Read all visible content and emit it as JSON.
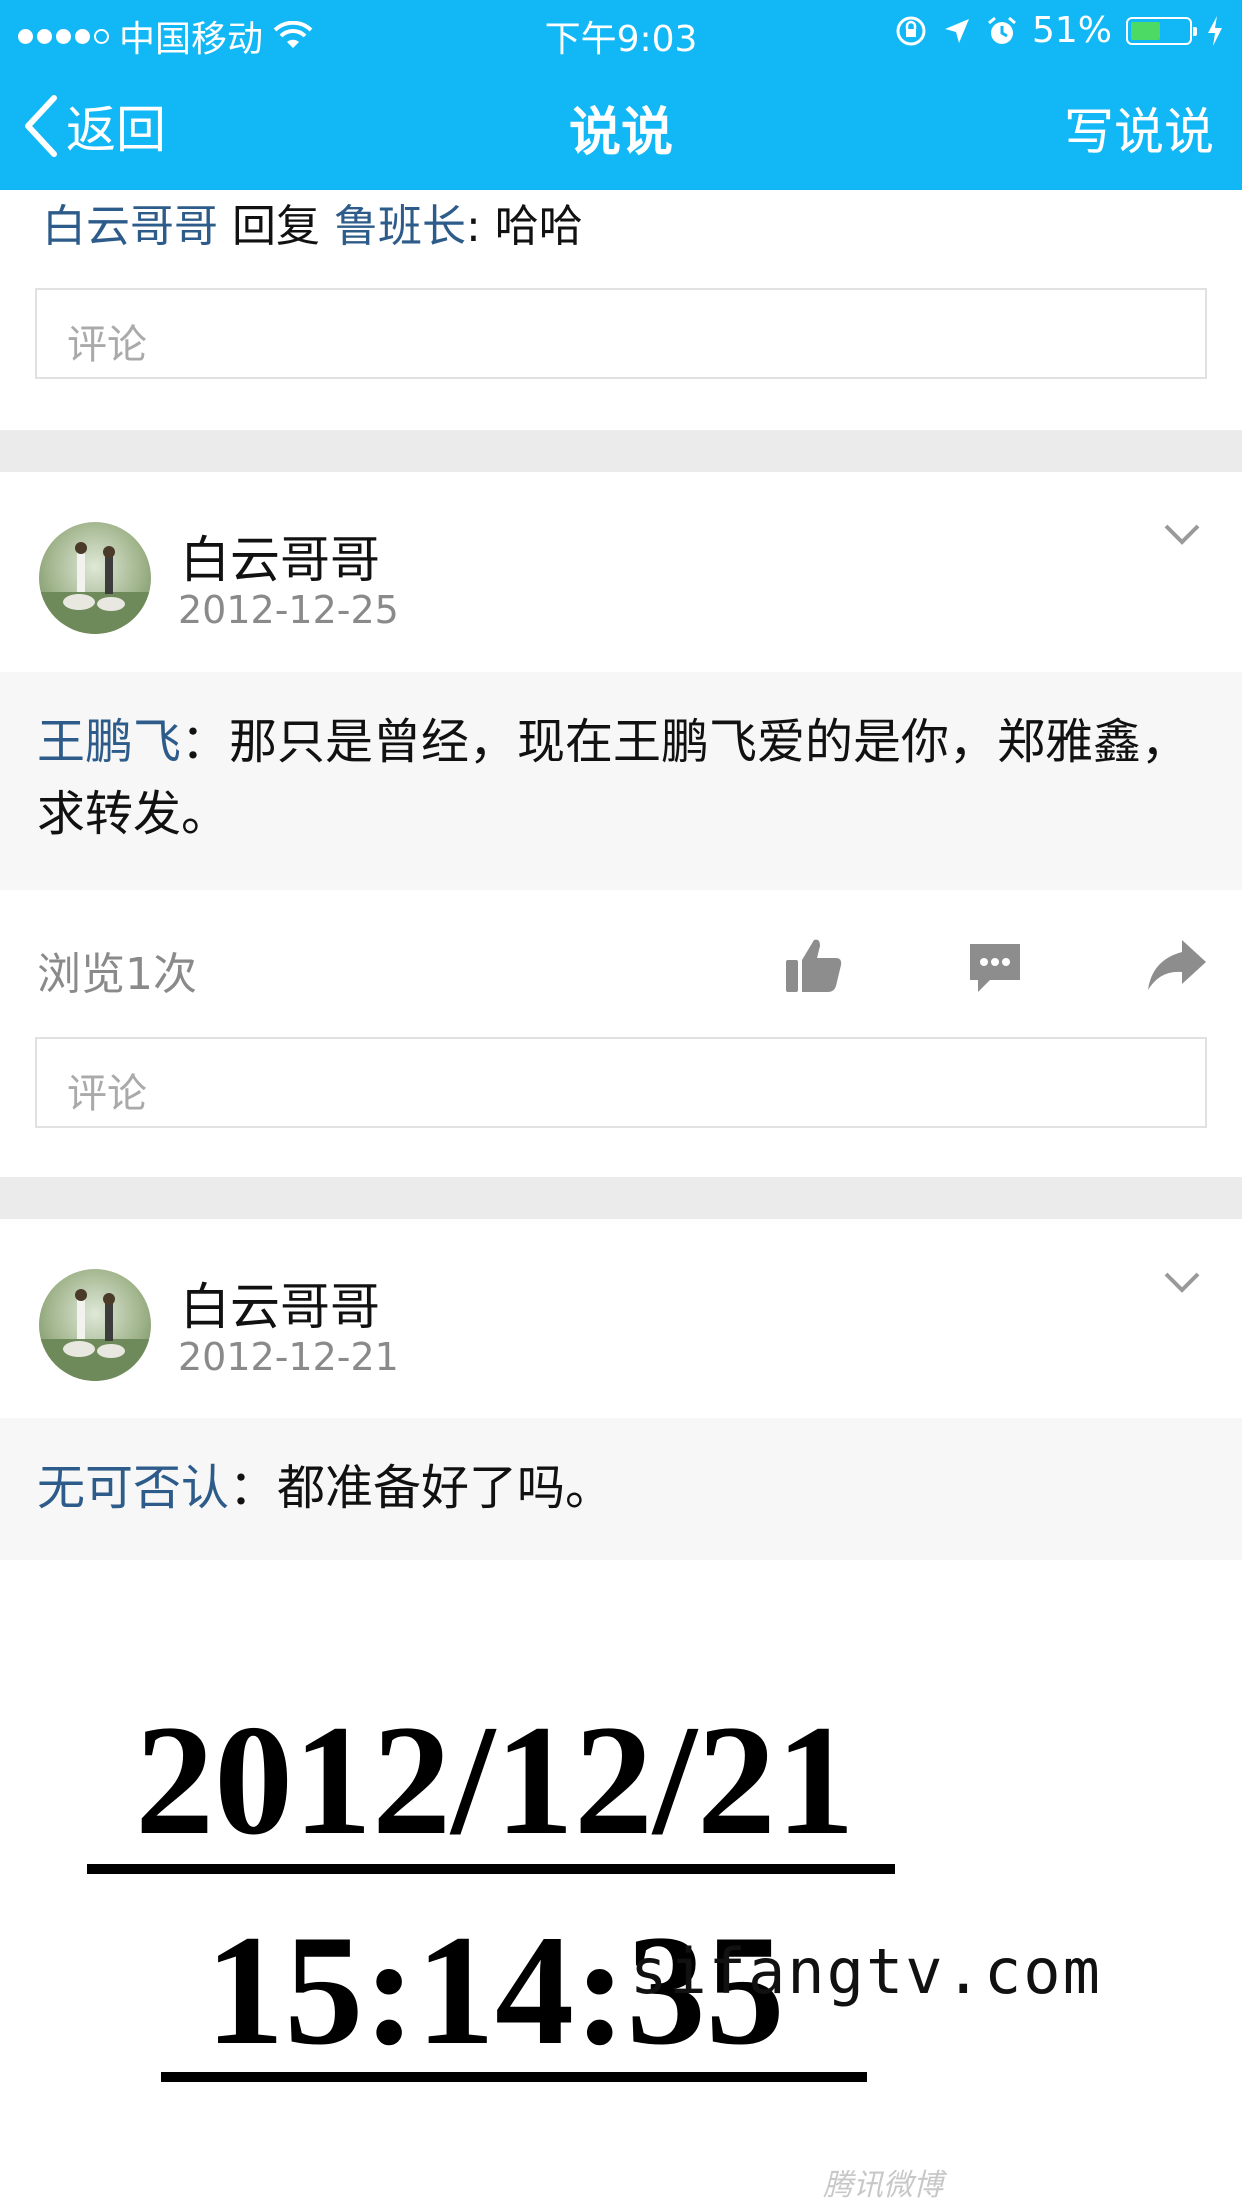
{
  "status_bar": {
    "carrier": "中国移动",
    "time": "下午9:03",
    "battery_text": "51%",
    "battery_level": 0.51,
    "battery_color": "#4cd964"
  },
  "nav": {
    "back_label": "返回",
    "title": "说说",
    "write_label": "写说说",
    "color": "#12b7f5"
  },
  "top_reply": {
    "from": "白云哥哥",
    "verb": "回复",
    "to": "鲁班长",
    "text": ": 哈哈",
    "comment_placeholder": "评论"
  },
  "posts": [
    {
      "author": "白云哥哥",
      "date": "2012-12-25",
      "mention": "王鹏飞",
      "separator": "：",
      "text": "那只是曾经，现在王鹏飞爱的是你，郑雅鑫，求转发。",
      "views": "浏览1次",
      "comment_placeholder": "评论"
    },
    {
      "author": "白云哥哥",
      "date": "2012-12-21",
      "mention": "无可否认",
      "separator": "：",
      "text": "都准备好了吗。",
      "image": {
        "line1": "2012/12/21",
        "line2": "15:14:35",
        "logo_text": "腾讯微博"
      }
    }
  ],
  "watermark": "sifangtv.com",
  "icons": [
    "back-chevron-icon",
    "wifi-icon",
    "lock-rotation-icon",
    "location-icon",
    "alarm-icon",
    "battery-icon",
    "charging-icon",
    "expand-chevron-icon",
    "like-icon",
    "comment-icon",
    "share-icon"
  ]
}
